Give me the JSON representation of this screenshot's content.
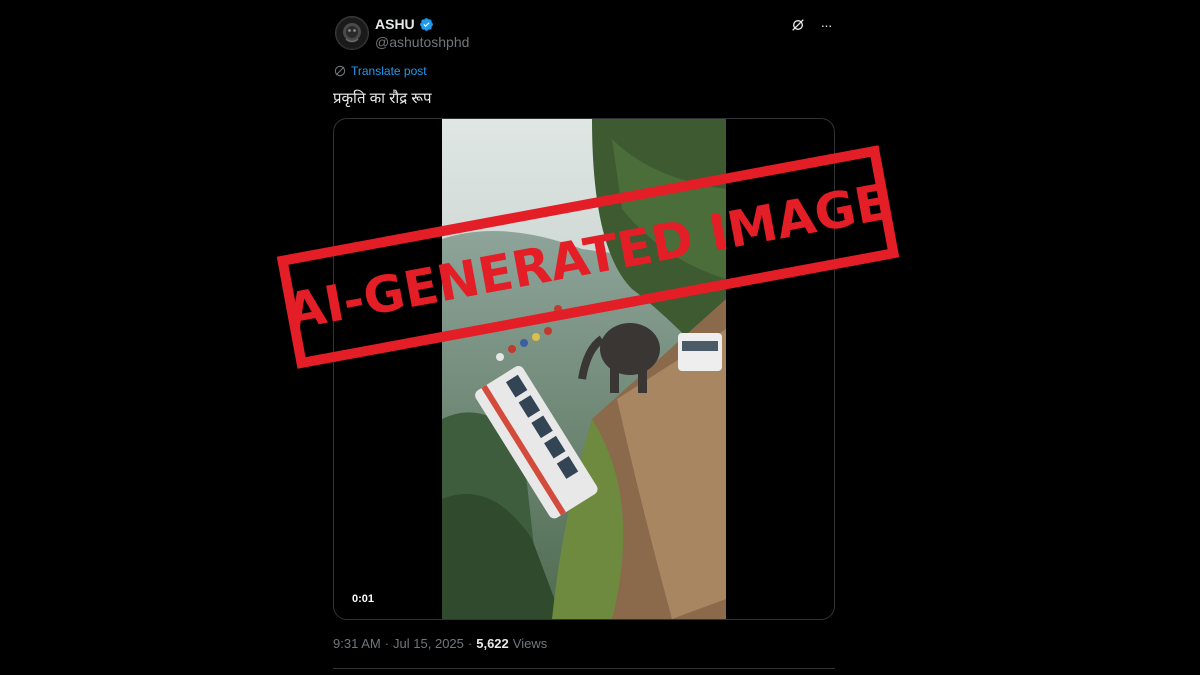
{
  "user": {
    "display_name": "ASHU",
    "handle": "@ashutoshphd",
    "verified": true
  },
  "actions": {
    "grok_icon": "grok-icon",
    "more_icon": "more-icon",
    "more_label": "···"
  },
  "tweet": {
    "translate_label": "Translate post",
    "text": "प्रकृति का रौद्र रूप"
  },
  "media": {
    "type": "video",
    "time": "0:01"
  },
  "meta": {
    "time": "9:31 AM",
    "separator": "·",
    "date": "Jul 15, 2025",
    "views_count": "5,622",
    "views_label": "Views"
  },
  "overlay": {
    "stamp_text": "AI-GENERATED IMAGE"
  },
  "colors": {
    "accent": "#1d9bf0",
    "stamp": "#e41e26",
    "background": "#000000",
    "muted": "#71767b"
  }
}
